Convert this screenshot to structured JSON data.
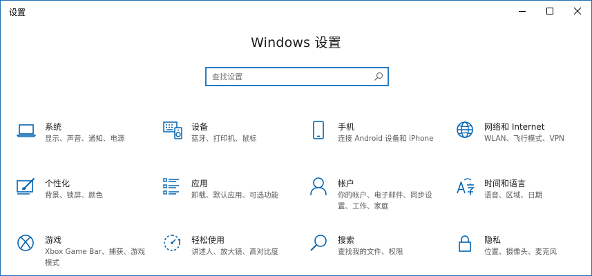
{
  "window": {
    "title": "设置"
  },
  "page": {
    "title": "Windows 设置"
  },
  "search": {
    "placeholder": "查找设置",
    "value": ""
  },
  "tiles": [
    {
      "label": "系统",
      "desc": "显示、声音、通知、电源",
      "icon": "laptop-icon"
    },
    {
      "label": "设备",
      "desc": "蓝牙、打印机、鼠标",
      "icon": "keyboard-speaker-icon"
    },
    {
      "label": "手机",
      "desc": "连接 Android 设备和 iPhone",
      "icon": "phone-icon"
    },
    {
      "label": "网络和 Internet",
      "desc": "WLAN、飞行模式、VPN",
      "icon": "globe-icon"
    },
    {
      "label": "个性化",
      "desc": "背景、锁屏、颜色",
      "icon": "paint-brush-icon"
    },
    {
      "label": "应用",
      "desc": "卸载、默认应用、可选功能",
      "icon": "apps-list-icon"
    },
    {
      "label": "帐户",
      "desc": "你的帐户、电子邮件、同步设置、工作、家庭",
      "icon": "person-icon"
    },
    {
      "label": "时间和语言",
      "desc": "语音、区域、日期",
      "icon": "language-clock-icon"
    },
    {
      "label": "游戏",
      "desc": "Xbox Game Bar、捕获、游戏模式",
      "icon": "xbox-icon"
    },
    {
      "label": "轻松使用",
      "desc": "讲述人、放大镜、高对比度",
      "icon": "ease-of-access-icon"
    },
    {
      "label": "搜索",
      "desc": "查找我的文件、权限",
      "icon": "magnifier-icon"
    },
    {
      "label": "隐私",
      "desc": "位置、摄像头、麦克风",
      "icon": "lock-icon"
    }
  ],
  "colors": {
    "accent": "#0063b1",
    "border": "#1f6fb5",
    "search_border": "#2b7bc4",
    "secondary_text": "#5a5a5a"
  }
}
